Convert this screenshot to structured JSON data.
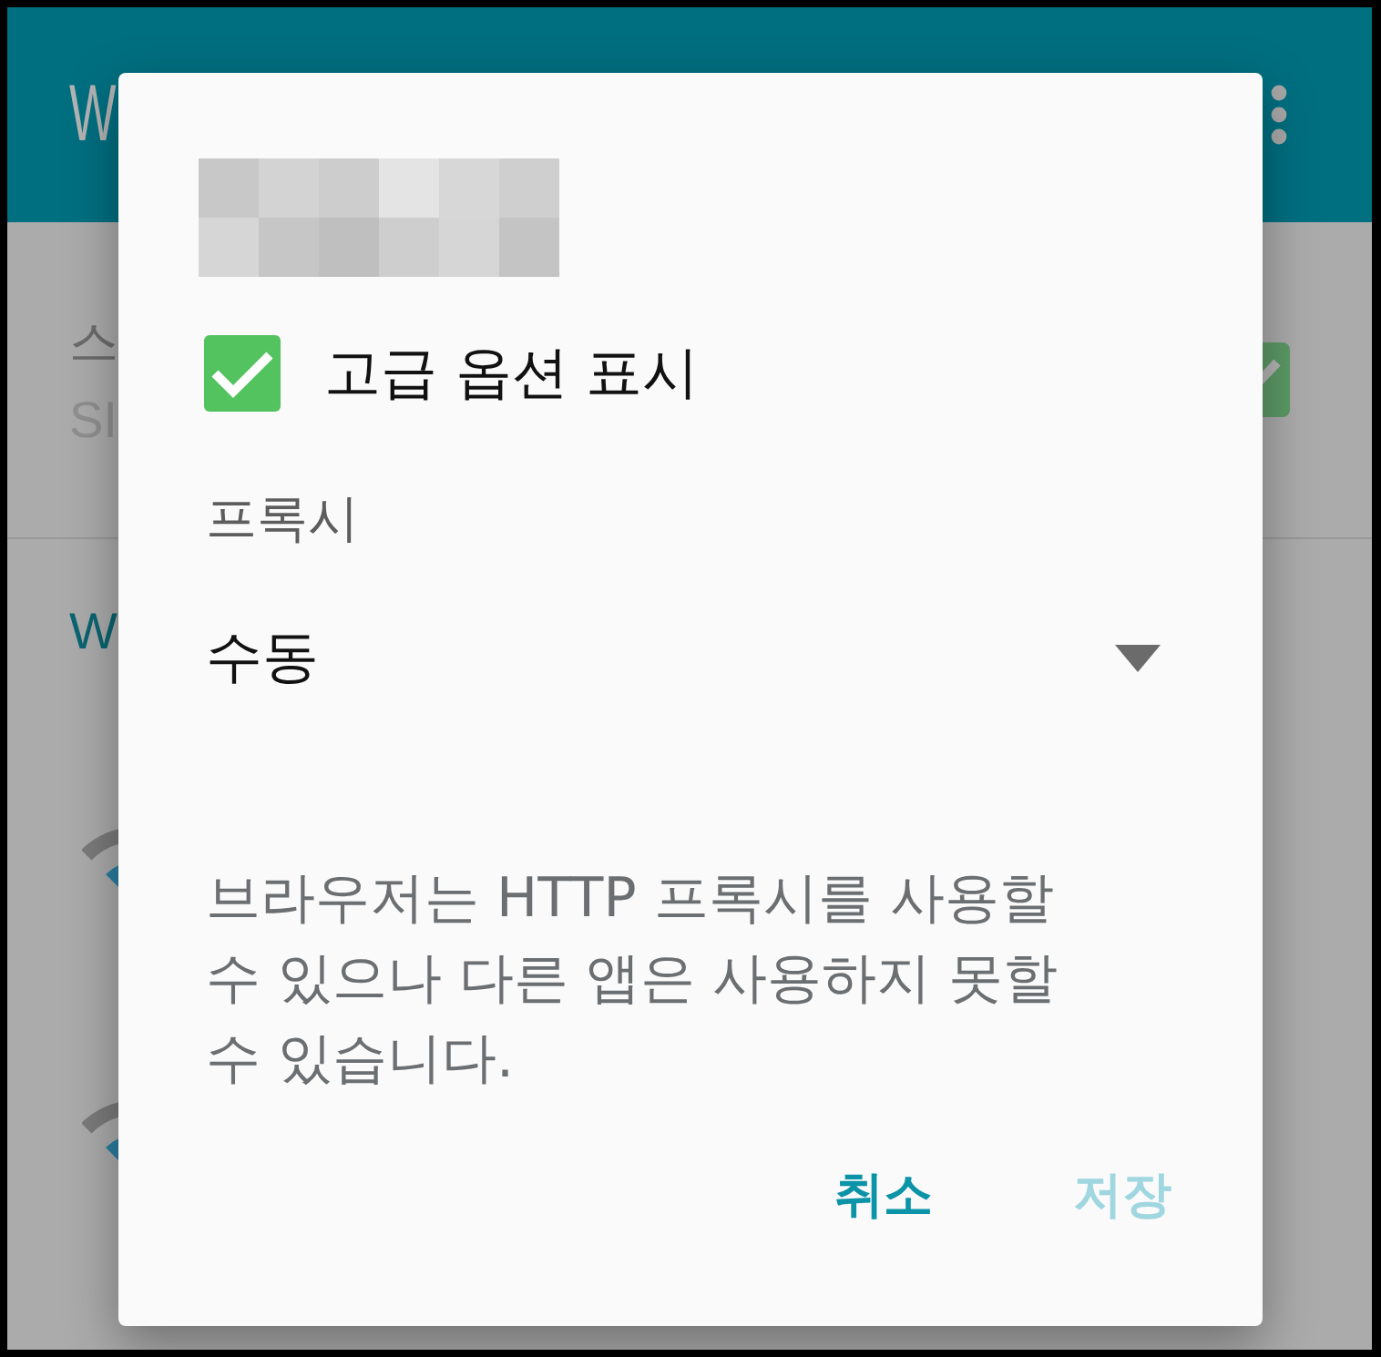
{
  "background": {
    "app_bar": {
      "title": "W"
    },
    "settings_row": {
      "title": "스",
      "subtitle": "SI",
      "checked": true
    },
    "section_header": "W"
  },
  "dialog": {
    "advanced_options": {
      "label": "고급 옵션 표시",
      "checked": true
    },
    "proxy": {
      "label": "프록시",
      "value": "수동"
    },
    "note": "브라우저는 HTTP 프록시를 사용할 수 있으나 다른 앱은 사용하지 못할 수 있습니다.",
    "buttons": [
      {
        "label": "취소",
        "disabled": false
      },
      {
        "label": "저장",
        "disabled": true
      }
    ]
  }
}
